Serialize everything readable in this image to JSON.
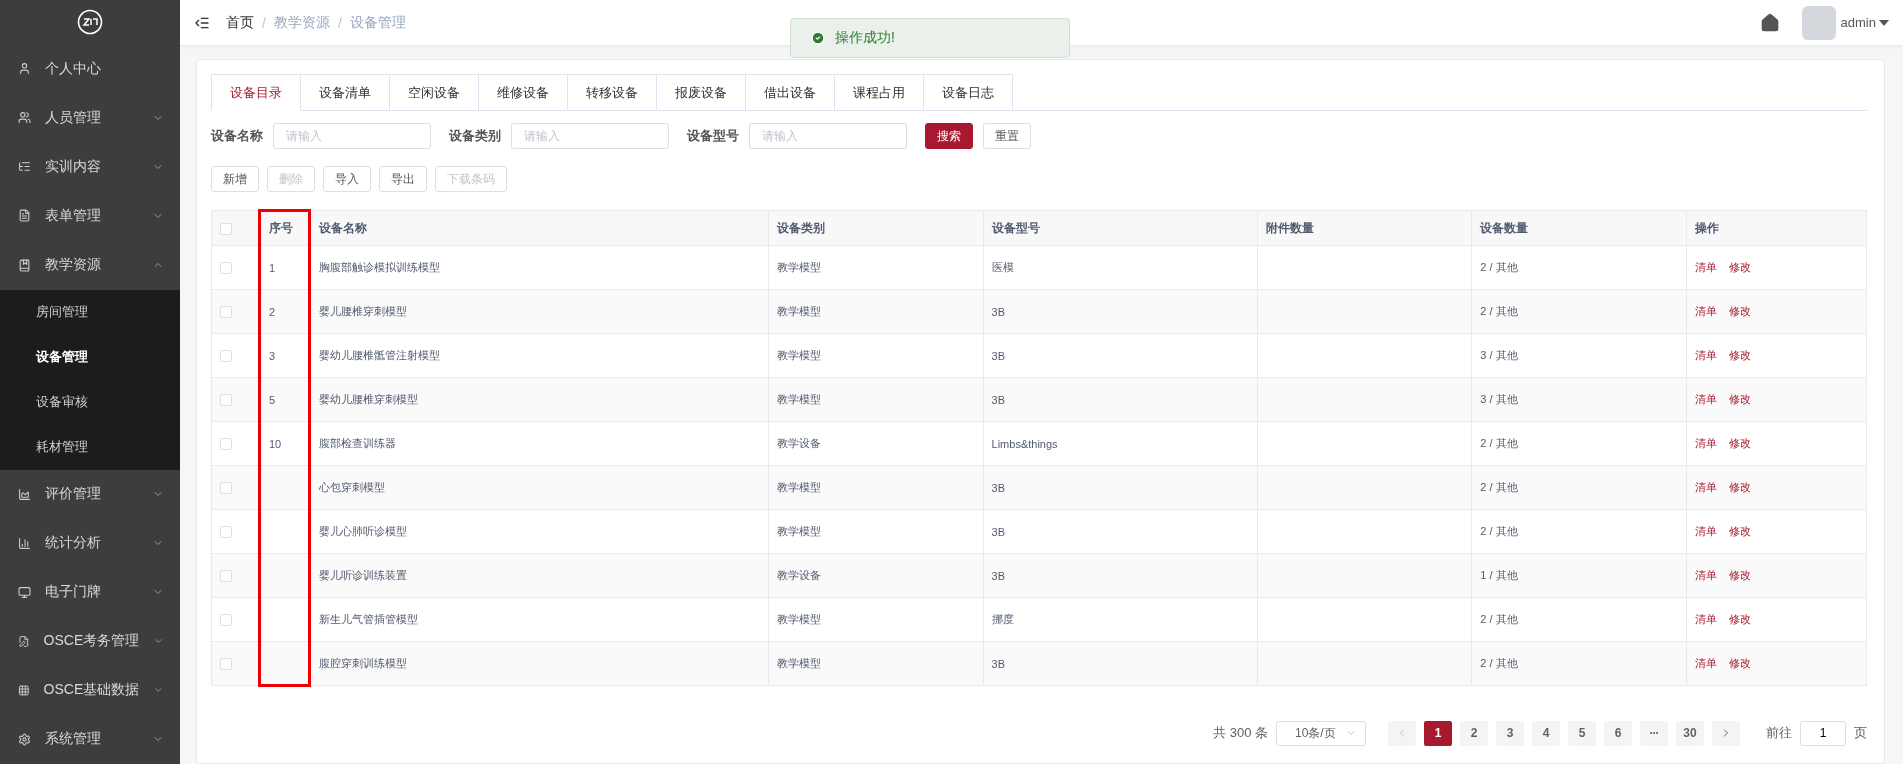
{
  "sidebar": {
    "items": [
      {
        "label": "个人中心",
        "kind": "link"
      },
      {
        "label": "人员管理",
        "kind": "group",
        "expanded": false
      },
      {
        "label": "实训内容",
        "kind": "group",
        "expanded": false
      },
      {
        "label": "表单管理",
        "kind": "group",
        "expanded": false
      },
      {
        "label": "教学资源",
        "kind": "group",
        "expanded": true,
        "children": [
          {
            "label": "房间管理",
            "selected": false
          },
          {
            "label": "设备管理",
            "selected": true
          },
          {
            "label": "设备审核",
            "selected": false
          },
          {
            "label": "耗材管理",
            "selected": false
          }
        ]
      },
      {
        "label": "评价管理",
        "kind": "group",
        "expanded": false
      },
      {
        "label": "统计分析",
        "kind": "group",
        "expanded": false
      },
      {
        "label": "电子门牌",
        "kind": "group",
        "expanded": false
      },
      {
        "label": "OSCE考务管理",
        "kind": "group",
        "expanded": false
      },
      {
        "label": "OSCE基础数据",
        "kind": "group",
        "expanded": false
      },
      {
        "label": "系统管理",
        "kind": "group",
        "expanded": false
      }
    ]
  },
  "breadcrumb": [
    "首页",
    "教学资源",
    "设备管理"
  ],
  "breadcrumb_separator": "/",
  "user": {
    "name": "admin"
  },
  "toast": {
    "message": "操作成功!"
  },
  "tabs": [
    {
      "label": "设备目录",
      "selected": true
    },
    {
      "label": "设备清单",
      "selected": false
    },
    {
      "label": "空闲设备",
      "selected": false
    },
    {
      "label": "维修设备",
      "selected": false
    },
    {
      "label": "转移设备",
      "selected": false
    },
    {
      "label": "报废设备",
      "selected": false
    },
    {
      "label": "借出设备",
      "selected": false
    },
    {
      "label": "课程占用",
      "selected": false
    },
    {
      "label": "设备日志",
      "selected": false
    }
  ],
  "filters": [
    {
      "label": "设备名称",
      "placeholder": "请输入"
    },
    {
      "label": "设备类别",
      "placeholder": "请输入"
    },
    {
      "label": "设备型号",
      "placeholder": "请输入"
    }
  ],
  "search_buttons": [
    {
      "label": "搜索",
      "kind": "primary"
    },
    {
      "label": "重置",
      "kind": "plain"
    }
  ],
  "actions": [
    {
      "label": "新增",
      "disabled": false
    },
    {
      "label": "删除",
      "disabled": true
    },
    {
      "label": "导入",
      "disabled": false
    },
    {
      "label": "导出",
      "disabled": false
    },
    {
      "label": "下载条码",
      "disabled": true
    }
  ],
  "table": {
    "all_checked": false,
    "columns": [
      {
        "label": "序号",
        "highlighted": true
      },
      {
        "label": "设备名称",
        "highlighted": false
      },
      {
        "label": "设备类别",
        "highlighted": false
      },
      {
        "label": "设备型号",
        "highlighted": false
      },
      {
        "label": "附件数量",
        "highlighted": false
      },
      {
        "label": "设备数量",
        "highlighted": false
      },
      {
        "label": "操作",
        "highlighted": false
      }
    ],
    "rows": [
      {
        "checked": false,
        "cells": [
          "1",
          "胸腹部触诊模拟训练模型",
          "教学模型",
          "医模",
          "",
          "2 / 其他"
        ],
        "links": [
          "清单",
          "修改"
        ]
      },
      {
        "checked": false,
        "cells": [
          "2",
          "婴儿腰椎穿刺模型",
          "教学模型",
          "3B",
          "",
          "2 / 其他"
        ],
        "links": [
          "清单",
          "修改"
        ]
      },
      {
        "checked": false,
        "cells": [
          "3",
          "婴幼儿腰椎骶管注射模型",
          "教学模型",
          "3B",
          "",
          "3 / 其他"
        ],
        "links": [
          "清单",
          "修改"
        ]
      },
      {
        "checked": false,
        "cells": [
          "5",
          "婴幼儿腰椎穿刺模型",
          "教学模型",
          "3B",
          "",
          "3 / 其他"
        ],
        "links": [
          "清单",
          "修改"
        ]
      },
      {
        "checked": false,
        "cells": [
          "10",
          "腹部检查训练器",
          "教学设备",
          "Limbs&things",
          "",
          "2 / 其他"
        ],
        "links": [
          "清单",
          "修改"
        ]
      },
      {
        "checked": false,
        "cells": [
          "",
          "心包穿刺模型",
          "教学模型",
          "3B",
          "",
          "2 / 其他"
        ],
        "links": [
          "清单",
          "修改"
        ]
      },
      {
        "checked": false,
        "cells": [
          "",
          "婴儿心肺听诊模型",
          "教学模型",
          "3B",
          "",
          "2 / 其他"
        ],
        "links": [
          "清单",
          "修改"
        ]
      },
      {
        "checked": false,
        "cells": [
          "",
          "婴儿听诊训练装置",
          "教学设备",
          "3B",
          "",
          "1 / 其他"
        ],
        "links": [
          "清单",
          "修改"
        ]
      },
      {
        "checked": false,
        "cells": [
          "",
          "新生儿气管插管模型",
          "教学模型",
          "挪度",
          "",
          "2 / 其他"
        ],
        "links": [
          "清单",
          "修改"
        ]
      },
      {
        "checked": false,
        "cells": [
          "",
          "腹腔穿刺训练模型",
          "教学模型",
          "3B",
          "",
          "2 / 其他"
        ],
        "links": [
          "清单",
          "修改"
        ]
      }
    ]
  },
  "pagination": {
    "total": "共 300 条",
    "page_size": "10条/页",
    "prev_disabled": true,
    "pages": [
      {
        "label": "1",
        "kind": "page",
        "selected": true
      },
      {
        "label": "2",
        "kind": "page",
        "selected": false
      },
      {
        "label": "3",
        "kind": "page",
        "selected": false
      },
      {
        "label": "4",
        "kind": "page",
        "selected": false
      },
      {
        "label": "5",
        "kind": "page",
        "selected": false
      },
      {
        "label": "6",
        "kind": "page",
        "selected": false
      },
      {
        "label": "···",
        "kind": "more",
        "selected": false
      },
      {
        "label": "30",
        "kind": "page",
        "selected": false
      }
    ],
    "goto_label": "前往",
    "goto_value": "1",
    "goto_suffix": "页"
  }
}
